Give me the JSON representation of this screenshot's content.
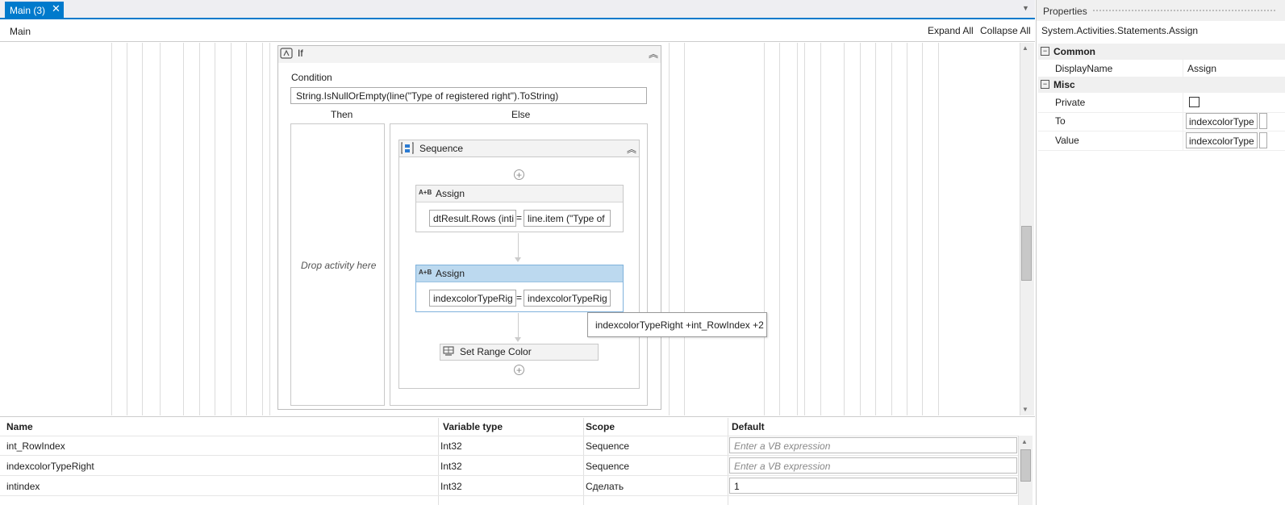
{
  "tab": {
    "label": "Main (3)",
    "close": "✕",
    "dropdown": "▼"
  },
  "designer": {
    "breadcrumb": "Main",
    "expand_all": "Expand All",
    "collapse_all": "Collapse All"
  },
  "if_activity": {
    "title": "If",
    "collapse": "︽",
    "condition_label": "Condition",
    "condition": "String.IsNullOrEmpty(line(\"Type of registered right\").ToString)",
    "then_label": "Then",
    "else_label": "Else",
    "drop_hint": "Drop activity here"
  },
  "sequence": {
    "title": "Sequence",
    "collapse": "︽",
    "add": "+"
  },
  "assign_1": {
    "icon": "A+B",
    "title": "Assign",
    "to": "dtResult.Rows (inti",
    "eq": "=",
    "value": "line.item (\"Type of"
  },
  "assign_2": {
    "icon": "A+B",
    "title": "Assign",
    "to": "indexcolorTypeRig",
    "eq": "=",
    "value": "indexcolorTypeRig"
  },
  "tooltip": "indexcolorTypeRight +int_RowIndex +2",
  "set_range": {
    "title": "Set Range Color"
  },
  "variables": {
    "headers": {
      "name": "Name",
      "type": "Variable type",
      "scope": "Scope",
      "default": "Default"
    },
    "rows": [
      {
        "name": "int_RowIndex",
        "type": "Int32",
        "scope": "Sequence",
        "default": "Enter a VB expression"
      },
      {
        "name": "indexcolorTypeRight",
        "type": "Int32",
        "scope": "Sequence",
        "default": "Enter a VB expression"
      },
      {
        "name": "intindex",
        "type": "Int32",
        "scope": "Сделать",
        "default": "1"
      }
    ]
  },
  "properties": {
    "title": "Properties",
    "type": "System.Activities.Statements.Assign",
    "categories": {
      "common": "Common",
      "misc": "Misc"
    },
    "display_name": {
      "key": "DisplayName",
      "value": "Assign"
    },
    "private": {
      "key": "Private"
    },
    "to": {
      "key": "To",
      "value": "indexcolorType"
    },
    "value": {
      "key": "Value",
      "value": "indexcolorType"
    },
    "collapse_glyph": "−"
  },
  "icons": {
    "if": "if-activity-icon",
    "sequence": "sequence-icon",
    "assign": "assign-icon",
    "set_range": "set-range-color-icon",
    "add": "add-activity-icon"
  },
  "colors": {
    "accent": "#007acc",
    "selected_header": "#bcd9ef"
  }
}
